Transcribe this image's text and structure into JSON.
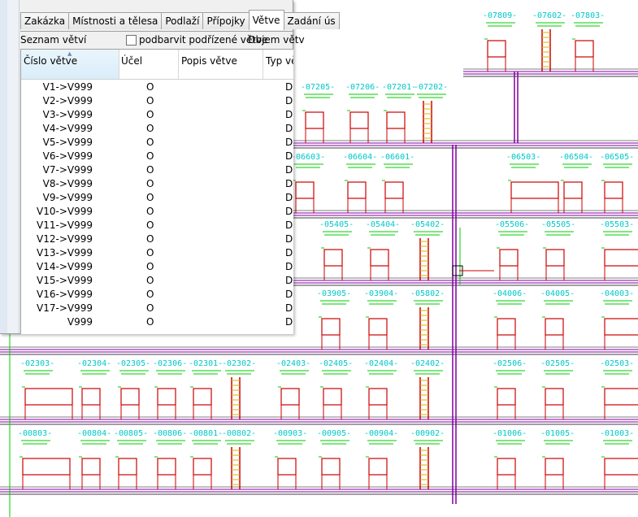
{
  "tabs": [
    {
      "label": "Zakázka",
      "active": false
    },
    {
      "label": "Místnosti a tělesa",
      "active": false
    },
    {
      "label": "Podlaží",
      "active": false
    },
    {
      "label": "Přípojky",
      "active": false
    },
    {
      "label": "Větve",
      "active": true
    },
    {
      "label": "Zadání ús",
      "active": false
    }
  ],
  "toolbar": {
    "list_label": "Seznam větví",
    "checkbox_label": "podbarvit podřízené větve",
    "checkbox_checked": false,
    "volume_label": "Objem větv"
  },
  "grid": {
    "columns": [
      "Číslo větve",
      "Účel",
      "Popis větve",
      "Typ větv"
    ],
    "rows": [
      {
        "cislo": "V1->V999",
        "ucel": "O",
        "popis": "",
        "typ": "D"
      },
      {
        "cislo": "V2->V999",
        "ucel": "O",
        "popis": "",
        "typ": "D"
      },
      {
        "cislo": "V3->V999",
        "ucel": "O",
        "popis": "",
        "typ": "D"
      },
      {
        "cislo": "V4->V999",
        "ucel": "O",
        "popis": "",
        "typ": "D"
      },
      {
        "cislo": "V5->V999",
        "ucel": "O",
        "popis": "",
        "typ": "D"
      },
      {
        "cislo": "V6->V999",
        "ucel": "O",
        "popis": "",
        "typ": "D"
      },
      {
        "cislo": "V7->V999",
        "ucel": "O",
        "popis": "",
        "typ": "D"
      },
      {
        "cislo": "V8->V999",
        "ucel": "O",
        "popis": "",
        "typ": "D"
      },
      {
        "cislo": "V9->V999",
        "ucel": "O",
        "popis": "",
        "typ": "D"
      },
      {
        "cislo": "V10->V999",
        "ucel": "O",
        "popis": "",
        "typ": "D"
      },
      {
        "cislo": "V11->V999",
        "ucel": "O",
        "popis": "",
        "typ": "D"
      },
      {
        "cislo": "V12->V999",
        "ucel": "O",
        "popis": "",
        "typ": "D"
      },
      {
        "cislo": "V13->V999",
        "ucel": "O",
        "popis": "",
        "typ": "D"
      },
      {
        "cislo": "V14->V999",
        "ucel": "O",
        "popis": "",
        "typ": "D"
      },
      {
        "cislo": "V15->V999",
        "ucel": "O",
        "popis": "",
        "typ": "D"
      },
      {
        "cislo": "V16->V999",
        "ucel": "O",
        "popis": "",
        "typ": "D"
      },
      {
        "cislo": "V17->V999",
        "ucel": "O",
        "popis": "",
        "typ": "D"
      },
      {
        "cislo": "V999",
        "ucel": "O",
        "popis": "",
        "typ": "D"
      }
    ]
  },
  "drawing": {
    "colors": {
      "label": "#00c8c8",
      "riser": "#cc0000",
      "ladder": "#e0b000",
      "pipe": "#8000a0",
      "tag": "#00cc00",
      "line": "#000000"
    },
    "floors": [
      {
        "key": "f7",
        "rooms": [
          "07809",
          "07602",
          "07803"
        ]
      },
      {
        "key": "f7b",
        "rooms": [
          "07205",
          "07206",
          "07201",
          "07202"
        ]
      },
      {
        "key": "f6",
        "rooms": [
          "06603",
          "06604",
          "06601",
          "06503",
          "06504",
          "06505"
        ]
      },
      {
        "key": "f5",
        "rooms": [
          "05405",
          "05404",
          "05402",
          "05506",
          "05505",
          "05503"
        ]
      },
      {
        "key": "f4",
        "rooms": [
          "03905",
          "03904",
          "05802",
          "04006",
          "04005",
          "04003"
        ]
      },
      {
        "key": "f3",
        "rooms": [
          "02303",
          "02304",
          "02305",
          "02306",
          "02301",
          "02302",
          "02403",
          "02405",
          "02404",
          "02402",
          "02506",
          "02505",
          "02503"
        ]
      },
      {
        "key": "f2",
        "rooms": [
          "00803",
          "00804",
          "00805",
          "00806",
          "00801",
          "00802",
          "00903",
          "00905",
          "00904",
          "00902",
          "01006",
          "01005",
          "01003"
        ]
      }
    ]
  }
}
